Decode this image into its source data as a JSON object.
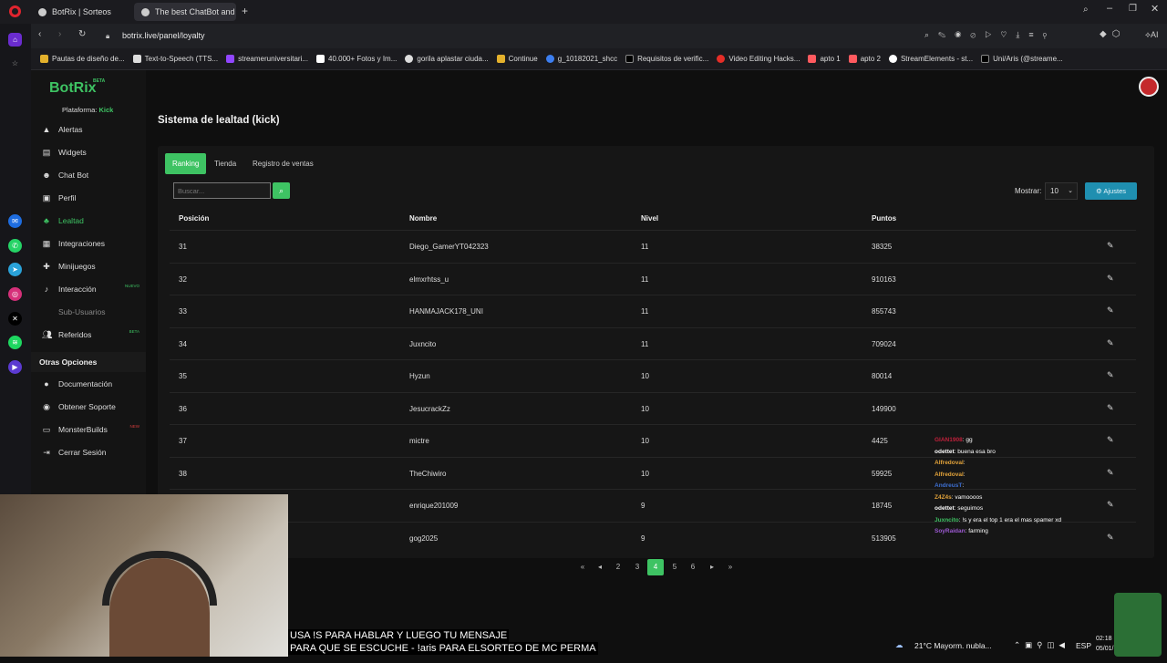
{
  "browser": {
    "tabs": [
      {
        "label": "BotRix | Sorteos"
      },
      {
        "label": "The best ChatBot and Wi..."
      }
    ],
    "url": "botrix.live/panel/loyalty",
    "bookmarks": [
      "Pautas de diseño de...",
      "Text-to-Speech (TTS...",
      "streameruniversitari...",
      "40.000+ Fotos y Im...",
      "gorila aplastar ciuda...",
      "Continue",
      "g_10182021_shcc",
      "Requisitos de verific...",
      "Video Editing Hacks...",
      "apto 1",
      "apto 2",
      "StreamElements - st...",
      "Uni/Aris (@streame..."
    ]
  },
  "app": {
    "logo": "BotRix",
    "logo_badge": "BETA",
    "platform_label": "Plataforma:",
    "platform_value": "Kick",
    "sidebar": [
      {
        "label": "Alertas",
        "icon": "warning-icon"
      },
      {
        "label": "Widgets",
        "icon": "widgets-icon"
      },
      {
        "label": "Chat Bot",
        "icon": "robot-icon"
      },
      {
        "label": "Perfil",
        "icon": "profile-icon"
      },
      {
        "label": "Lealtad",
        "icon": "loyalty-icon"
      },
      {
        "label": "Integraciones",
        "icon": "integrations-icon"
      },
      {
        "label": "Minijuegos",
        "icon": "games-icon"
      },
      {
        "label": "Interacción",
        "icon": "interaction-icon",
        "badge": "NUEVO"
      },
      {
        "label": "Sub-Usuarios",
        "icon": "subusers-icon"
      },
      {
        "label": "Referidos",
        "icon": "referrals-icon",
        "badge": "BETA"
      }
    ],
    "other_options_title": "Otras Opciones",
    "other_options": [
      {
        "label": "Documentación",
        "icon": "docs-icon"
      },
      {
        "label": "Obtener Soporte",
        "icon": "support-icon"
      },
      {
        "label": "MonsterBuilds",
        "icon": "monster-icon",
        "badge": "NEW"
      },
      {
        "label": "Cerrar Sesión",
        "icon": "logout-icon"
      }
    ]
  },
  "main": {
    "title": "Sistema de lealtad (kick)",
    "tabs": [
      "Ranking",
      "Tienda",
      "Registro de ventas"
    ],
    "search_placeholder": "Buscar...",
    "show_label": "Mostrar:",
    "show_value": "10",
    "settings_label": "Ajustes",
    "columns": [
      "Posición",
      "Nombre",
      "Nivel",
      "Puntos"
    ],
    "rows": [
      {
        "pos": "31",
        "name": "Diego_GamerYT042323",
        "level": "11",
        "points": "38325"
      },
      {
        "pos": "32",
        "name": "elmxrhtss_u",
        "level": "11",
        "points": "910163"
      },
      {
        "pos": "33",
        "name": "HANMAJACK178_UNI",
        "level": "11",
        "points": "855743"
      },
      {
        "pos": "34",
        "name": "Juxncito",
        "level": "11",
        "points": "709024"
      },
      {
        "pos": "35",
        "name": "Hyzun",
        "level": "10",
        "points": "80014"
      },
      {
        "pos": "36",
        "name": "JesucrackZz",
        "level": "10",
        "points": "149900"
      },
      {
        "pos": "37",
        "name": "mictre",
        "level": "10",
        "points": "4425"
      },
      {
        "pos": "38",
        "name": "TheChiwiro",
        "level": "10",
        "points": "59925"
      },
      {
        "pos": "",
        "name": "enrique201009",
        "level": "9",
        "points": "18745"
      },
      {
        "pos": "",
        "name": "gog2025",
        "level": "9",
        "points": "513905"
      }
    ],
    "pages": [
      "2",
      "3",
      "4",
      "5",
      "6"
    ],
    "current_page": "4"
  },
  "overlay": {
    "chat": [
      {
        "user": "GIAN1908",
        "msg": ": gg",
        "color": "#c0213b"
      },
      {
        "user": "odettet",
        "msg": ": buena esa bro",
        "color": "#ffffff"
      },
      {
        "user": "Alfredoval",
        "msg": ":",
        "color": "#e3a33a"
      },
      {
        "user": "Alfredoval",
        "msg": ":",
        "color": "#e3a33a"
      },
      {
        "user": "AndreusT",
        "msg": ":",
        "color": "#3d6fd1"
      },
      {
        "user": "Z4Z4s",
        "msg": ": vamoooos",
        "color": "#e3a33a"
      },
      {
        "user": "odettet",
        "msg": ": seguimos",
        "color": "#ffffff"
      },
      {
        "user": "Juxncito",
        "msg": ": !s y era el top 1 era el mas spamer xd",
        "color": "#3ec363"
      },
      {
        "user": "SoyRaidan",
        "msg": ": farming",
        "color": "#9b59d0"
      }
    ],
    "subtitle_line1": "USA !S PARA HABLAR Y LUEGO TU MENSAJE",
    "subtitle_line2": "PARA QUE SE ESCUCHE - !aris PARA ELSORTEO DE MC PERMA",
    "weather": "21°C  Mayorm. nubla...",
    "lang": "ESP",
    "time": "02:18",
    "date": "05/01/"
  }
}
